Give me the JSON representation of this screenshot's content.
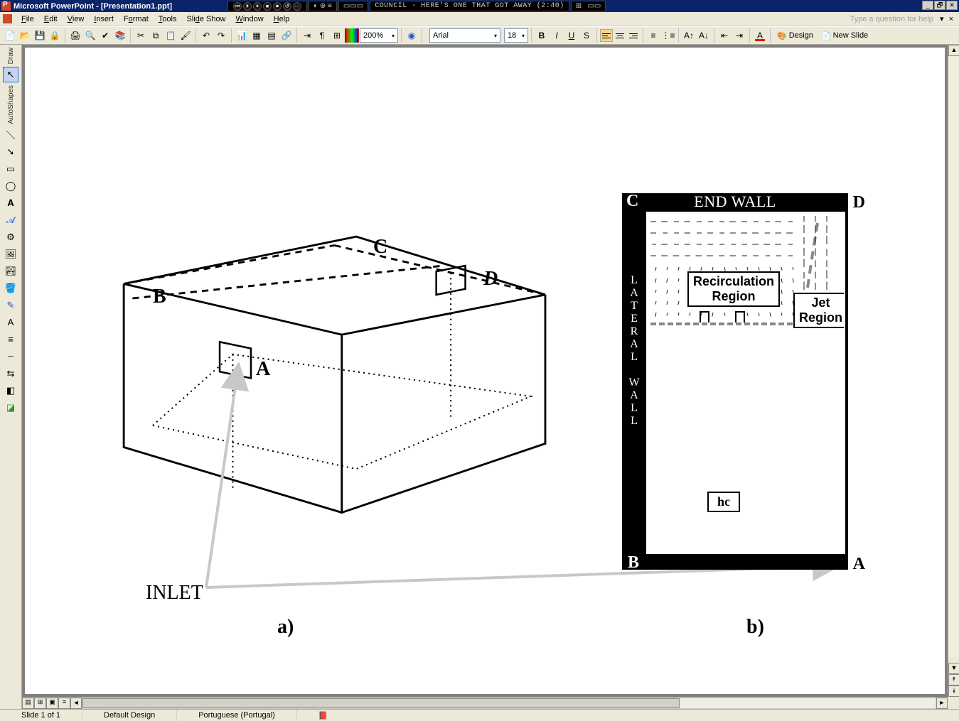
{
  "title": "Microsoft PowerPoint - [Presentation1.ppt]",
  "taskbar": {
    "song": "COUNCIL - HERE'S ONE THAT GOT AWAY (2:40)",
    "media_glyphs": [
      "⏮",
      "⏵",
      "⏸",
      "⏹",
      "⏺",
      "↺",
      "—"
    ]
  },
  "window_buttons": {
    "min": "_",
    "restore": "🗗",
    "close": "✕",
    "doc_min": "_",
    "doc_restore": "🗗",
    "doc_close": "✕"
  },
  "menus": [
    "File",
    "Edit",
    "View",
    "Insert",
    "Format",
    "Tools",
    "Slide Show",
    "Window",
    "Help"
  ],
  "question_help": "Type a question for help",
  "toolbar": {
    "zoom": "200%",
    "font": "Arial",
    "size": "18",
    "B": "B",
    "I": "I",
    "U": "U",
    "S": "S",
    "design": "Design",
    "newslide": "New Slide",
    "undo": "↶",
    "redo": "↷"
  },
  "left_toolbar": {
    "draw": "Draw",
    "autoshapes": "AutoShapes"
  },
  "status": {
    "slide": "Slide 1 of 1",
    "design": "Default Design",
    "lang": "Portuguese (Portugal)"
  },
  "slide": {
    "labels": {
      "A": "A",
      "B": "B",
      "C": "C",
      "D": "D",
      "inlet": "INLET",
      "a": "a)",
      "b": "b)"
    },
    "panel_b": {
      "endwall": "END WALL",
      "lateral": "L\nA\nT\nE\nR\nA\nL\n\nW\nA\nL\nL",
      "C": "C",
      "D": "D",
      "B": "B",
      "A": "A",
      "recirc": "Recirculation\nRegion",
      "jet": "Jet\nRegion",
      "hc": "hc"
    }
  }
}
